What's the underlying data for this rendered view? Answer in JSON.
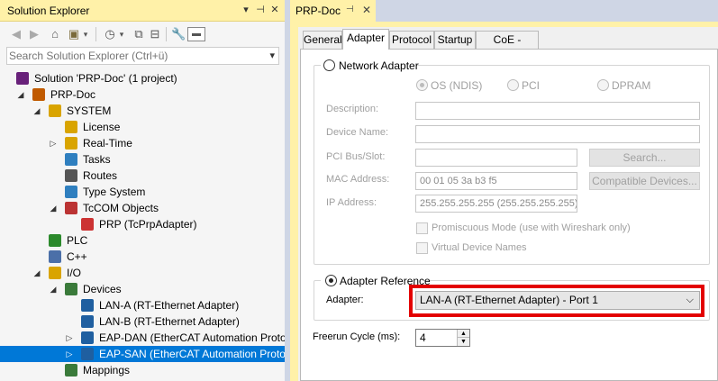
{
  "solution_explorer": {
    "title": "Solution Explorer",
    "search_placeholder": "Search Solution Explorer (Ctrl+ü)",
    "tree": [
      {
        "label": "Solution 'PRP-Doc' (1 project)",
        "icon": "solution-icon",
        "depth": 0,
        "expander": ""
      },
      {
        "label": "PRP-Doc",
        "icon": "project-icon",
        "depth": 1,
        "expander": "expanded"
      },
      {
        "label": "SYSTEM",
        "icon": "system-icon",
        "depth": 2,
        "expander": "expanded"
      },
      {
        "label": "License",
        "icon": "license-icon",
        "depth": 3,
        "expander": ""
      },
      {
        "label": "Real-Time",
        "icon": "realtime-icon",
        "depth": 3,
        "expander": "collapsed"
      },
      {
        "label": "Tasks",
        "icon": "tasks-icon",
        "depth": 3,
        "expander": ""
      },
      {
        "label": "Routes",
        "icon": "routes-icon",
        "depth": 3,
        "expander": ""
      },
      {
        "label": "Type System",
        "icon": "type-system-icon",
        "depth": 3,
        "expander": ""
      },
      {
        "label": "TcCOM Objects",
        "icon": "tccom-icon",
        "depth": 3,
        "expander": "expanded"
      },
      {
        "label": "PRP (TcPrpAdapter)",
        "icon": "prp-object-icon",
        "depth": 4,
        "expander": ""
      },
      {
        "label": "PLC",
        "icon": "plc-icon",
        "depth": 2,
        "expander": ""
      },
      {
        "label": "C++",
        "icon": "cpp-icon",
        "depth": 2,
        "expander": ""
      },
      {
        "label": "I/O",
        "icon": "io-icon",
        "depth": 2,
        "expander": "expanded"
      },
      {
        "label": "Devices",
        "icon": "devices-icon",
        "depth": 3,
        "expander": "expanded"
      },
      {
        "label": "LAN-A (RT-Ethernet Adapter)",
        "icon": "ethernet-adapter-icon",
        "depth": 4,
        "expander": ""
      },
      {
        "label": "LAN-B (RT-Ethernet Adapter)",
        "icon": "ethernet-adapter-icon",
        "depth": 4,
        "expander": ""
      },
      {
        "label": "EAP-DAN (EtherCAT Automation Proto",
        "icon": "eap-device-icon",
        "depth": 4,
        "expander": "collapsed"
      },
      {
        "label": "EAP-SAN (EtherCAT Automation Proto",
        "icon": "eap-device-icon",
        "depth": 4,
        "expander": "collapsed",
        "selected": true
      },
      {
        "label": "Mappings",
        "icon": "mappings-icon",
        "depth": 3,
        "expander": ""
      }
    ]
  },
  "document": {
    "tab_title": "PRP-Doc",
    "tabs": [
      "General",
      "Adapter",
      "Protocol",
      "Startup",
      "CoE - Online"
    ],
    "active_tab": "Adapter",
    "network_adapter": {
      "label": "Network Adapter",
      "options": [
        "OS (NDIS)",
        "PCI",
        "DPRAM"
      ],
      "description_label": "Description:",
      "description_value": "",
      "device_name_label": "Device Name:",
      "device_name_value": "",
      "pci_label": "PCI Bus/Slot:",
      "pci_value": "",
      "search_button": "Search...",
      "mac_label": "MAC Address:",
      "mac_value": "00 01 05 3a b3 f5",
      "compatible_button": "Compatible Devices...",
      "ip_label": "IP Address:",
      "ip_value": "255.255.255.255 (255.255.255.255)",
      "promiscuous_label": "Promiscuous Mode (use with Wireshark only)",
      "virtual_label": "Virtual Device Names"
    },
    "adapter_reference": {
      "label": "Adapter Reference",
      "adapter_label": "Adapter:",
      "adapter_value": "LAN-A (RT-Ethernet Adapter) - Port 1"
    },
    "freerun": {
      "label": "Freerun Cycle (ms):",
      "value": "4"
    },
    "colors": {
      "highlight": "#e30000",
      "selection": "#0078d7",
      "title_bar": "#fff1a8"
    }
  }
}
